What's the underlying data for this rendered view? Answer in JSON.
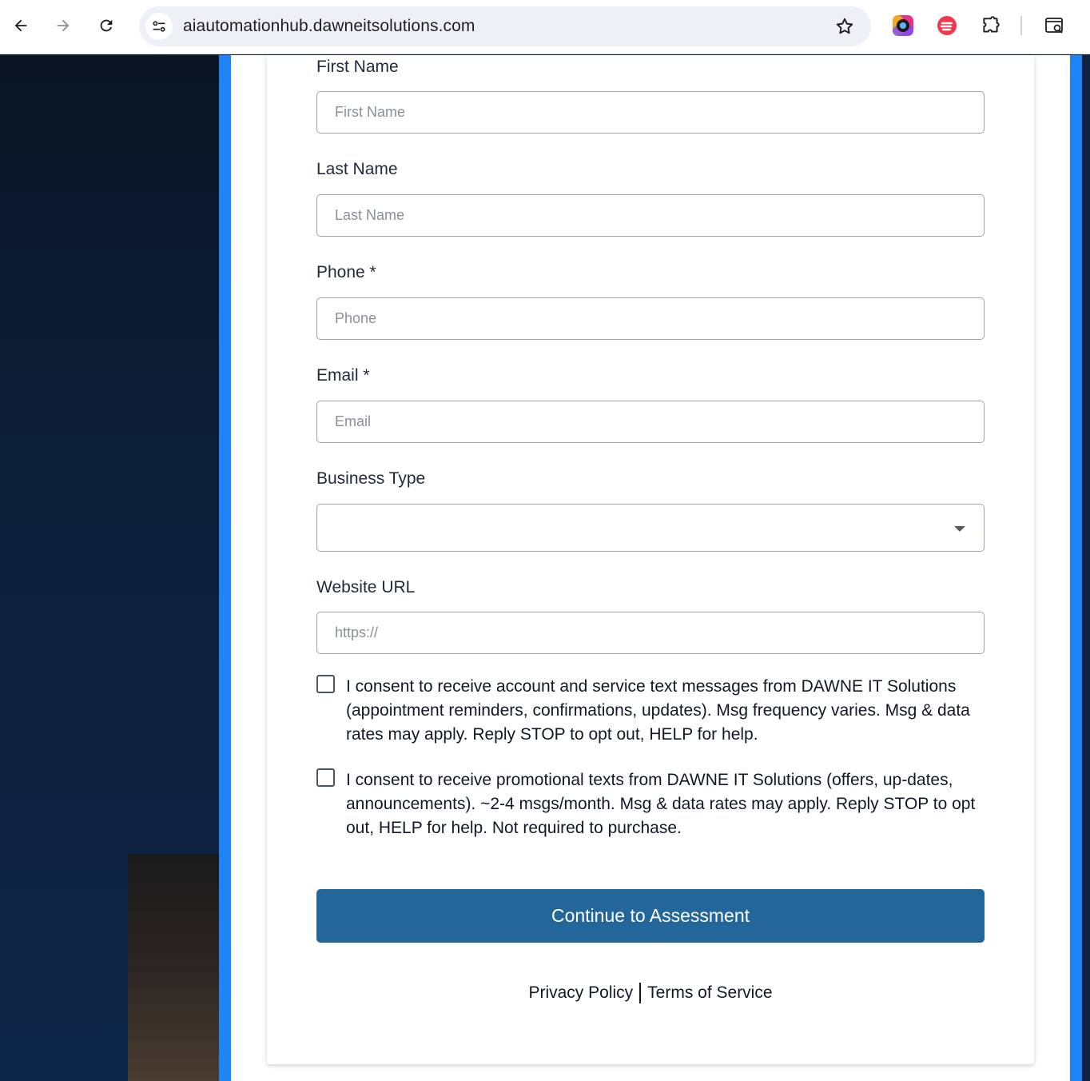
{
  "browser": {
    "url": "aiautomationhub.dawneitsolutions.com"
  },
  "form": {
    "first_name": {
      "label": "First Name",
      "placeholder": "First Name"
    },
    "last_name": {
      "label": "Last Name",
      "placeholder": "Last Name"
    },
    "phone": {
      "label": "Phone *",
      "placeholder": "Phone"
    },
    "email": {
      "label": "Email *",
      "placeholder": "Email"
    },
    "business_type": {
      "label": "Business Type",
      "value": ""
    },
    "website": {
      "label": "Website URL",
      "placeholder": "https://"
    },
    "consents": [
      {
        "text": "I consent to receive account and service text messages from DAWNE IT Solutions (appointment reminders, confirmations, updates). Msg frequency varies. Msg & data rates may apply. Reply STOP to opt out, HELP for help.",
        "checked": false
      },
      {
        "text": "I consent to receive promotional texts from DAWNE IT Solutions (offers, up-dates, announcements). ~2-4 msgs/month. Msg & data rates may apply. Reply STOP to opt out, HELP for help. Not required to purchase.",
        "checked": false
      }
    ],
    "submit_label": "Continue to Assessment"
  },
  "footer": {
    "privacy": "Privacy Policy",
    "terms": "Terms of Service"
  },
  "colors": {
    "accent_stripe": "#1f84f5",
    "button": "#236699"
  }
}
